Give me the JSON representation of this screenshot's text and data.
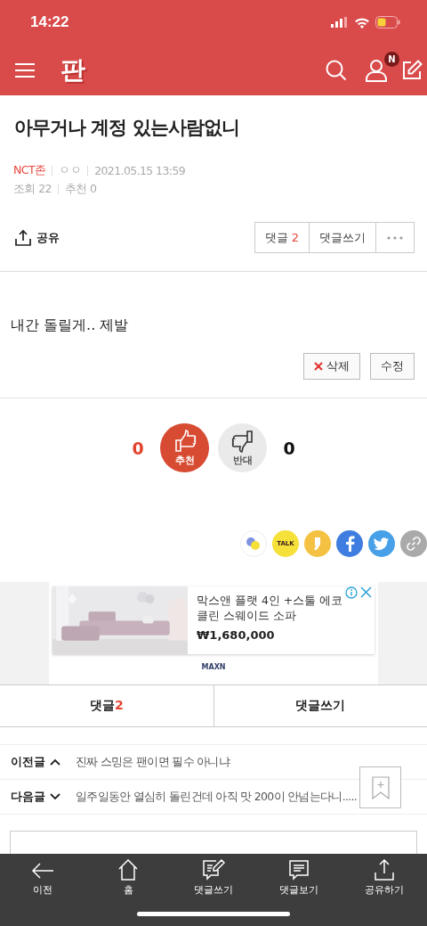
{
  "status_bar": {
    "time": "14:22"
  },
  "header": {
    "logo": "판",
    "notification_badge": "N"
  },
  "post": {
    "title": "아무거나 계정 있는사람없니",
    "board": "NCT존",
    "author": "ㅇㅇ",
    "date": "2021.05.15 13:59",
    "views_label": "조회",
    "views": "22",
    "recommend_label": "추천",
    "recommends": "0",
    "share": "공유",
    "comments_label": "댓글",
    "comments_count": "2",
    "write_comment": "댓글쓰기",
    "body": "내간 돌릴게.. 제발",
    "delete": "삭제",
    "edit": "수정"
  },
  "vote": {
    "up_count": "0",
    "up_label": "추천",
    "down_label": "반대",
    "down_count": "0"
  },
  "share_buttons": [
    {
      "kind": "band"
    },
    {
      "kind": "kakaotalk",
      "label": "TALK"
    },
    {
      "kind": "kakaostory"
    },
    {
      "kind": "facebook"
    },
    {
      "kind": "twitter"
    },
    {
      "kind": "link"
    }
  ],
  "ad": {
    "kind": "picture",
    "title": "막스앤 플랫 4인 +스툴 에코클린 스웨이드 소파",
    "price": "₩1,680,000",
    "brand": "MAXN"
  },
  "comment_tabs": [
    {
      "label": "댓글",
      "count": "2"
    },
    {
      "label": "댓글쓰기"
    }
  ],
  "nav_posts": [
    {
      "kind": "prev",
      "label": "이전글",
      "title": "진짜 스밍은 팬이면 필수 아니냐"
    },
    {
      "kind": "next",
      "label": "다음글",
      "title": "일주일동안 열심히 돌린건데 아직 맛 200이 안넘는다니....."
    }
  ],
  "bottom_bar": [
    {
      "kind": "back",
      "label": "이전"
    },
    {
      "kind": "home",
      "label": "홈"
    },
    {
      "kind": "write",
      "label": "댓글쓰기"
    },
    {
      "kind": "comments",
      "label": "댓글보기"
    },
    {
      "kind": "share",
      "label": "공유하기"
    }
  ]
}
